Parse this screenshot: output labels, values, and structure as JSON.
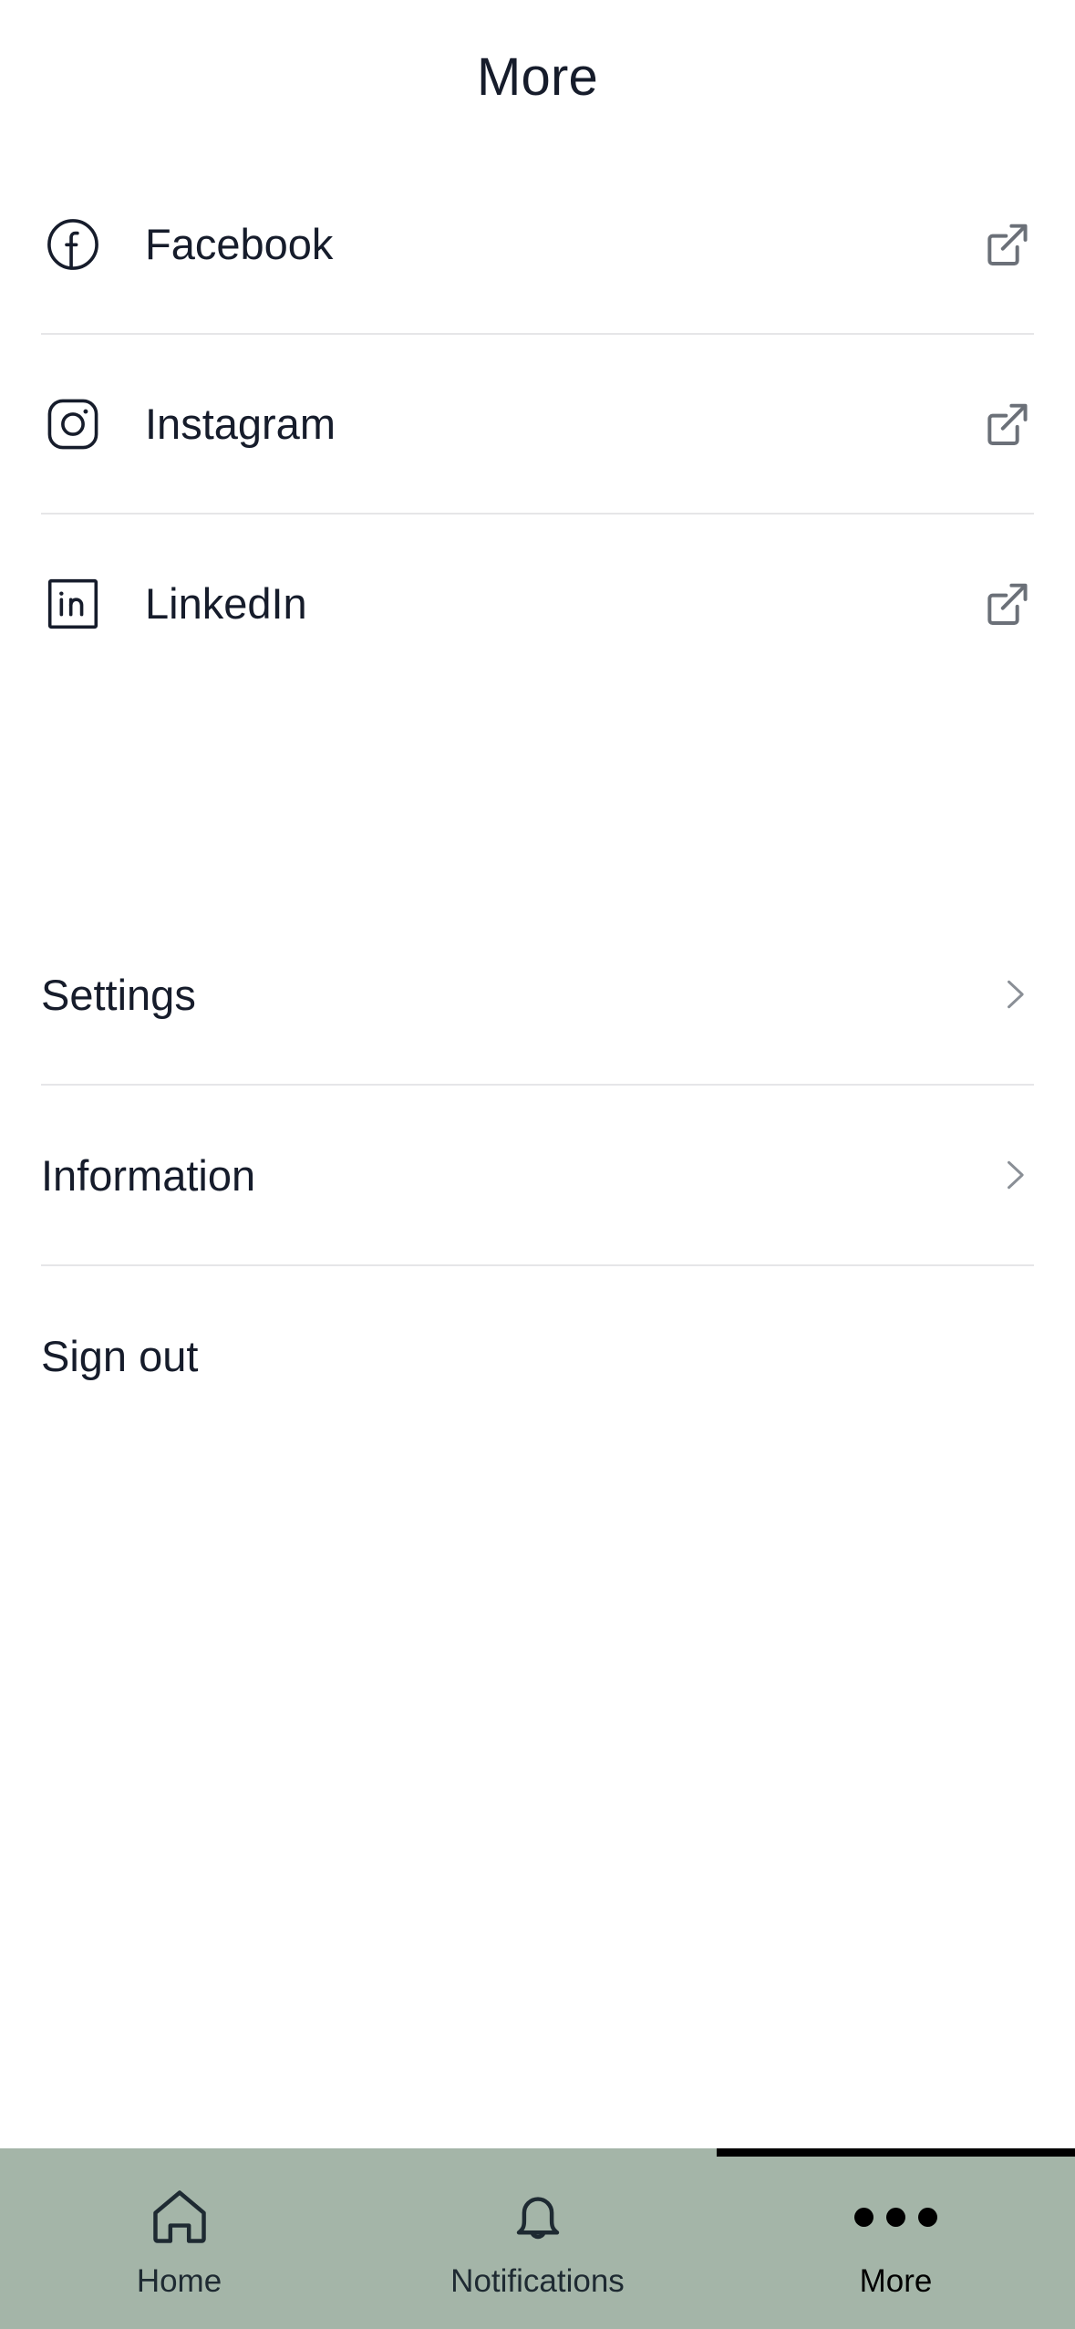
{
  "header": {
    "title": "More"
  },
  "colors": {
    "text_primary": "#161c2b",
    "divider": "#e6e6e8",
    "ext_icon": "#6b7078",
    "chevron": "#8a8f96",
    "nav_background": "#a4b5a8",
    "nav_indicator": "#000000",
    "nav_label": "#1e2a32",
    "page_background": "#ffffff"
  },
  "social_links": [
    {
      "label": "Facebook",
      "icon": "facebook-icon",
      "action_icon": "external-link-icon"
    },
    {
      "label": "Instagram",
      "icon": "instagram-icon",
      "action_icon": "external-link-icon"
    },
    {
      "label": "LinkedIn",
      "icon": "linkedin-icon",
      "action_icon": "external-link-icon"
    }
  ],
  "menu_items": [
    {
      "label": "Settings",
      "action_icon": "chevron-right-icon",
      "has_chevron": true
    },
    {
      "label": "Information",
      "action_icon": "chevron-right-icon",
      "has_chevron": true
    },
    {
      "label": "Sign out",
      "action_icon": "",
      "has_chevron": false
    }
  ],
  "bottom_nav": {
    "items": [
      {
        "label": "Home",
        "icon": "home-icon",
        "active": false
      },
      {
        "label": "Notifications",
        "icon": "bell-icon",
        "active": false
      },
      {
        "label": "More",
        "icon": "three-dots-icon",
        "active": true
      }
    ]
  }
}
